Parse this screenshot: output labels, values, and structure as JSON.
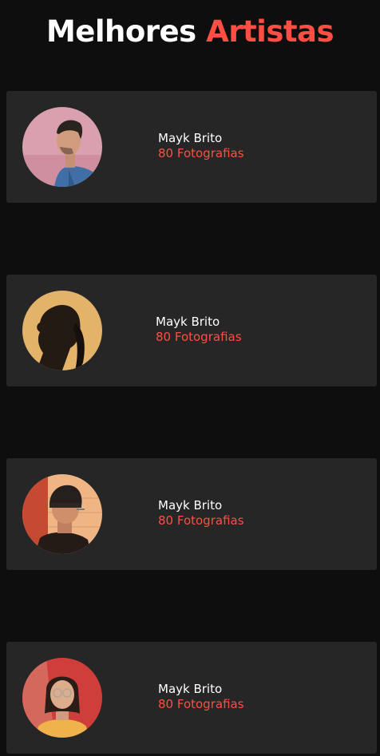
{
  "header": {
    "title_main": "Melhores",
    "title_accent": "Artistas"
  },
  "colors": {
    "background": "#0e0e0e",
    "card": "#262626",
    "accent": "#ff4f44",
    "text": "#ffffff"
  },
  "artists": [
    {
      "name": "Mayk Brito",
      "photos": "80 Fotografias"
    },
    {
      "name": "Mayk Brito",
      "photos": "80 Fotografias"
    },
    {
      "name": "Mayk Brito",
      "photos": "80 Fotografias"
    },
    {
      "name": "Mayk Brito",
      "photos": "80 Fotografias"
    }
  ]
}
